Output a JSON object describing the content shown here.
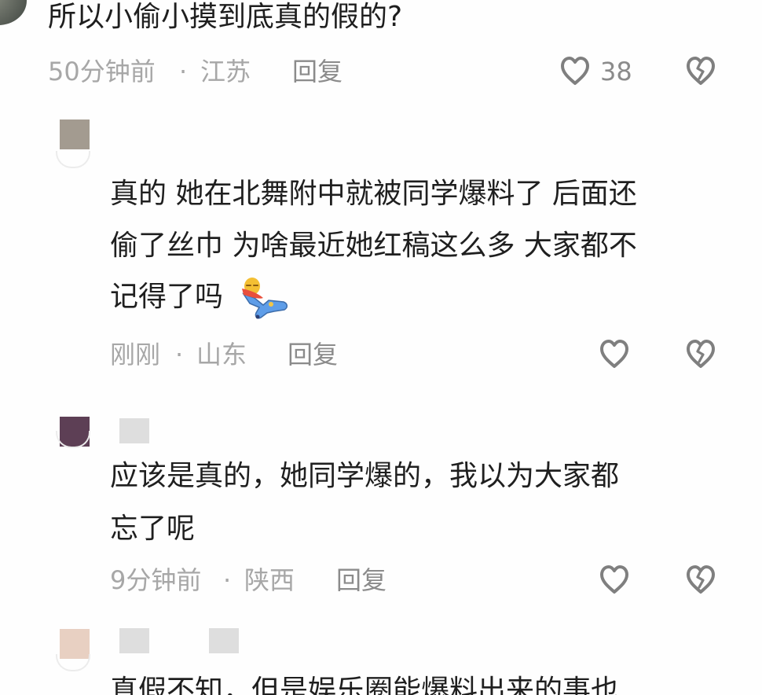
{
  "comments": [
    {
      "text": "所以小偷小摸到底真的假的?",
      "time": "50分钟前",
      "location": "江苏",
      "reply_label": "回复",
      "like_count": "38"
    },
    {
      "lines": [
        "真的 她在北舞附中就被同学爆料了 后面还",
        "偷了丝巾 为啥最近她红稿这么多 大家都不",
        "记得了吗"
      ],
      "emoji": "lying-character-emoji",
      "time": "刚刚",
      "location": "山东",
      "reply_label": "回复"
    },
    {
      "lines": [
        "应该是真的，她同学爆的，我以为大家都",
        "忘了呢"
      ],
      "time": "9分钟前",
      "location": "陕西",
      "reply_label": "回复"
    },
    {
      "lines": [
        "真假不知，但是娱乐圈能爆料出来的事也"
      ]
    }
  ],
  "separator": "·",
  "icons": {
    "like": "heart-outline-icon",
    "dislike": "broken-heart-icon"
  },
  "colors": {
    "text": "#1e1e1e",
    "meta": "#a7a7a7",
    "action": "#8b8b8b",
    "icon": "#7f7f7f"
  }
}
